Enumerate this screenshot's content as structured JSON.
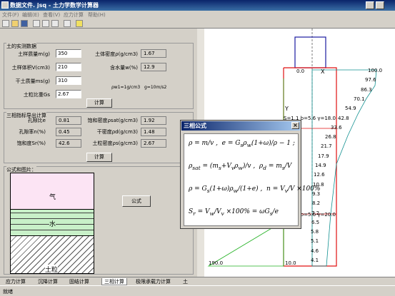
{
  "window": {
    "title": "数据文件. jsq - 土力学数学计算器"
  },
  "menu": [
    "文件(F)",
    "编辑(E)",
    "查看(V)",
    "应力计算",
    "帮助(H)"
  ],
  "g1": {
    "title": "土的实测数据",
    "mass_label": "土样质量m(g)",
    "mass": "350",
    "vol_label": "土样体积V(cm3)",
    "vol": "210",
    "dry_label": "干土质量ms(g)",
    "dry": "310",
    "gs_label": "土粒比重Gs",
    "gs": "2.67",
    "density_label": "土体密度ρ(g/cm3)",
    "density": "1.67",
    "water_label": "含水量w(%)",
    "water": "12.9",
    "note1": "ρw1=1g/cm3",
    "note2": "g=10m/s2",
    "button": "计算"
  },
  "g2": {
    "title": "三相指标导出计算",
    "e_label": "孔隙比e",
    "e": "0.81",
    "n_label": "孔隙率n(%)",
    "n": "0.45",
    "sr_label": "饱和度Sr(%)",
    "sr": "42.6",
    "sat_label": "饱和密度ρsat(g/cm3)",
    "sat": "1.92",
    "dryd_label": "干密度ρd(g/cm3)",
    "dryd": "1.48",
    "gr_label": "土粒密度ρs(g/cm3)",
    "gr": "2.67",
    "button": "计算"
  },
  "g3": {
    "title": "公式和图片：",
    "gas": "气",
    "water": "水",
    "soil": "土粒",
    "button": "公式"
  },
  "dialog": {
    "title": "三相公式"
  },
  "diagram": {
    "top_label": "0.0",
    "x_label": "X",
    "y_label": "Y",
    "layer1": "γ=18.0",
    "layer2": "γ=20.0",
    "bottom_left": "190.0",
    "bottom_mid": "10.0",
    "prefix1": "S=1.1 b=5.6 ",
    "prefix2": "S=1.1 b=5.6 ",
    "values": [
      "100.0",
      "97.6",
      "86.3",
      "70.1",
      "54.9",
      "42.8",
      "33.6",
      "26.8",
      "21.7",
      "17.9",
      "14.9",
      "12.6",
      "10.8",
      "9.3",
      "8.2",
      "7.2",
      "6.5",
      "5.8",
      "5.1",
      "4.6",
      "4.1"
    ]
  },
  "tabs": [
    "应力计算",
    "沉降计算",
    "固结计算",
    "三相计算",
    "极限承载力计算",
    "土"
  ],
  "status": "就绪"
}
